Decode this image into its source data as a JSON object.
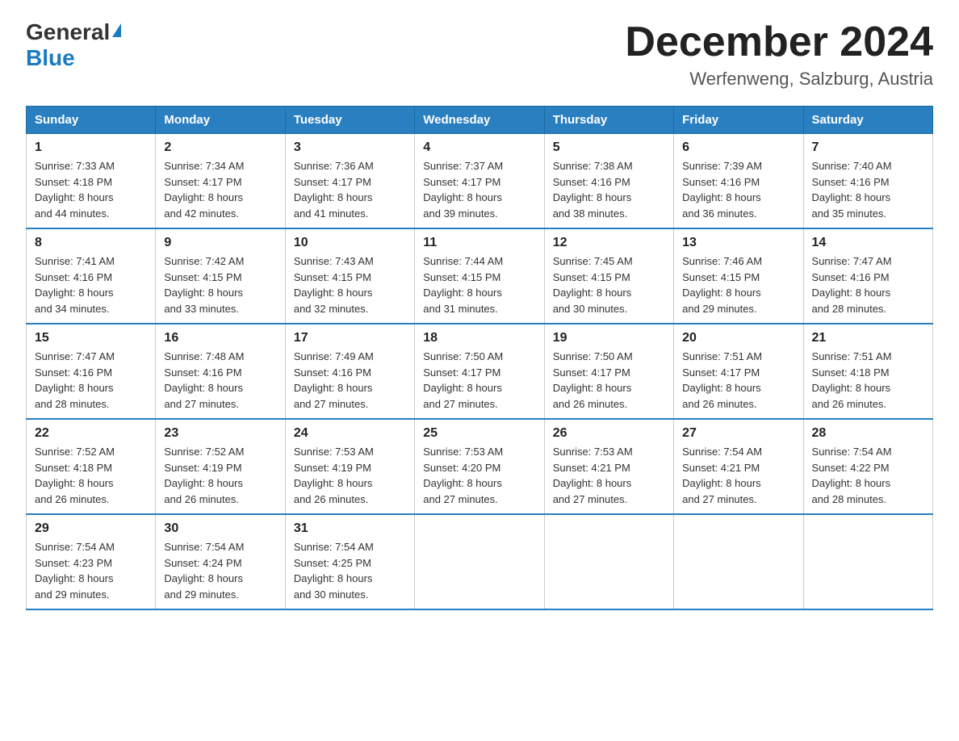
{
  "logo": {
    "general": "General",
    "blue": "Blue"
  },
  "title": "December 2024",
  "location": "Werfenweng, Salzburg, Austria",
  "days_of_week": [
    "Sunday",
    "Monday",
    "Tuesday",
    "Wednesday",
    "Thursday",
    "Friday",
    "Saturday"
  ],
  "weeks": [
    [
      {
        "day": "1",
        "sunrise": "7:33 AM",
        "sunset": "4:18 PM",
        "daylight": "8 hours and 44 minutes."
      },
      {
        "day": "2",
        "sunrise": "7:34 AM",
        "sunset": "4:17 PM",
        "daylight": "8 hours and 42 minutes."
      },
      {
        "day": "3",
        "sunrise": "7:36 AM",
        "sunset": "4:17 PM",
        "daylight": "8 hours and 41 minutes."
      },
      {
        "day": "4",
        "sunrise": "7:37 AM",
        "sunset": "4:17 PM",
        "daylight": "8 hours and 39 minutes."
      },
      {
        "day": "5",
        "sunrise": "7:38 AM",
        "sunset": "4:16 PM",
        "daylight": "8 hours and 38 minutes."
      },
      {
        "day": "6",
        "sunrise": "7:39 AM",
        "sunset": "4:16 PM",
        "daylight": "8 hours and 36 minutes."
      },
      {
        "day": "7",
        "sunrise": "7:40 AM",
        "sunset": "4:16 PM",
        "daylight": "8 hours and 35 minutes."
      }
    ],
    [
      {
        "day": "8",
        "sunrise": "7:41 AM",
        "sunset": "4:16 PM",
        "daylight": "8 hours and 34 minutes."
      },
      {
        "day": "9",
        "sunrise": "7:42 AM",
        "sunset": "4:15 PM",
        "daylight": "8 hours and 33 minutes."
      },
      {
        "day": "10",
        "sunrise": "7:43 AM",
        "sunset": "4:15 PM",
        "daylight": "8 hours and 32 minutes."
      },
      {
        "day": "11",
        "sunrise": "7:44 AM",
        "sunset": "4:15 PM",
        "daylight": "8 hours and 31 minutes."
      },
      {
        "day": "12",
        "sunrise": "7:45 AM",
        "sunset": "4:15 PM",
        "daylight": "8 hours and 30 minutes."
      },
      {
        "day": "13",
        "sunrise": "7:46 AM",
        "sunset": "4:15 PM",
        "daylight": "8 hours and 29 minutes."
      },
      {
        "day": "14",
        "sunrise": "7:47 AM",
        "sunset": "4:16 PM",
        "daylight": "8 hours and 28 minutes."
      }
    ],
    [
      {
        "day": "15",
        "sunrise": "7:47 AM",
        "sunset": "4:16 PM",
        "daylight": "8 hours and 28 minutes."
      },
      {
        "day": "16",
        "sunrise": "7:48 AM",
        "sunset": "4:16 PM",
        "daylight": "8 hours and 27 minutes."
      },
      {
        "day": "17",
        "sunrise": "7:49 AM",
        "sunset": "4:16 PM",
        "daylight": "8 hours and 27 minutes."
      },
      {
        "day": "18",
        "sunrise": "7:50 AM",
        "sunset": "4:17 PM",
        "daylight": "8 hours and 27 minutes."
      },
      {
        "day": "19",
        "sunrise": "7:50 AM",
        "sunset": "4:17 PM",
        "daylight": "8 hours and 26 minutes."
      },
      {
        "day": "20",
        "sunrise": "7:51 AM",
        "sunset": "4:17 PM",
        "daylight": "8 hours and 26 minutes."
      },
      {
        "day": "21",
        "sunrise": "7:51 AM",
        "sunset": "4:18 PM",
        "daylight": "8 hours and 26 minutes."
      }
    ],
    [
      {
        "day": "22",
        "sunrise": "7:52 AM",
        "sunset": "4:18 PM",
        "daylight": "8 hours and 26 minutes."
      },
      {
        "day": "23",
        "sunrise": "7:52 AM",
        "sunset": "4:19 PM",
        "daylight": "8 hours and 26 minutes."
      },
      {
        "day": "24",
        "sunrise": "7:53 AM",
        "sunset": "4:19 PM",
        "daylight": "8 hours and 26 minutes."
      },
      {
        "day": "25",
        "sunrise": "7:53 AM",
        "sunset": "4:20 PM",
        "daylight": "8 hours and 27 minutes."
      },
      {
        "day": "26",
        "sunrise": "7:53 AM",
        "sunset": "4:21 PM",
        "daylight": "8 hours and 27 minutes."
      },
      {
        "day": "27",
        "sunrise": "7:54 AM",
        "sunset": "4:21 PM",
        "daylight": "8 hours and 27 minutes."
      },
      {
        "day": "28",
        "sunrise": "7:54 AM",
        "sunset": "4:22 PM",
        "daylight": "8 hours and 28 minutes."
      }
    ],
    [
      {
        "day": "29",
        "sunrise": "7:54 AM",
        "sunset": "4:23 PM",
        "daylight": "8 hours and 29 minutes."
      },
      {
        "day": "30",
        "sunrise": "7:54 AM",
        "sunset": "4:24 PM",
        "daylight": "8 hours and 29 minutes."
      },
      {
        "day": "31",
        "sunrise": "7:54 AM",
        "sunset": "4:25 PM",
        "daylight": "8 hours and 30 minutes."
      },
      null,
      null,
      null,
      null
    ]
  ],
  "labels": {
    "sunrise": "Sunrise:",
    "sunset": "Sunset:",
    "daylight": "Daylight:"
  }
}
